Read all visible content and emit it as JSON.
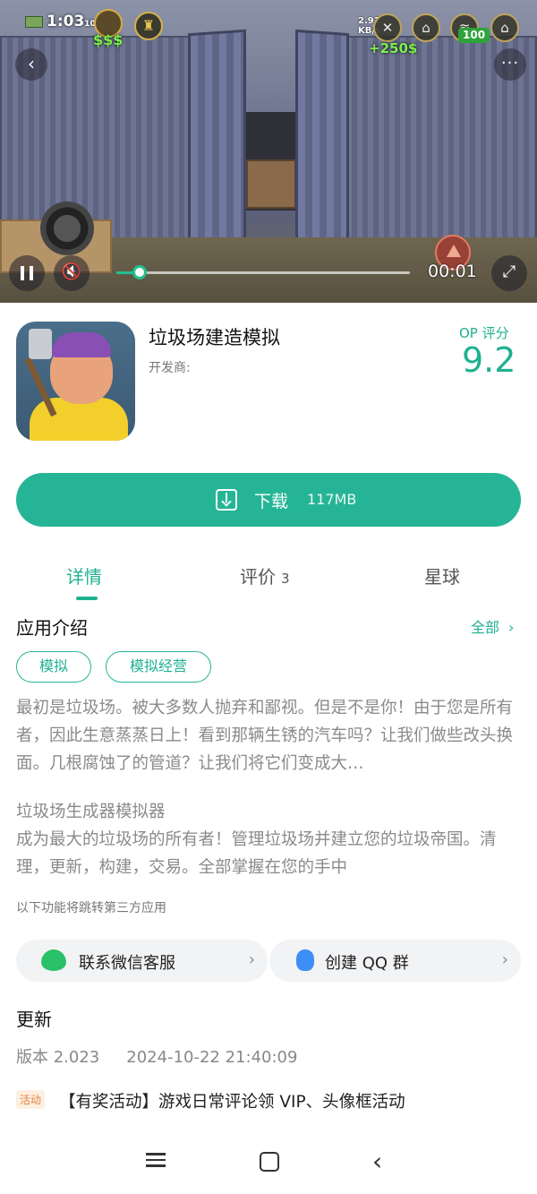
{
  "video": {
    "hud": {
      "cash": "1:03",
      "cash_suffix": "10",
      "dollars": "$$$",
      "net_speed": "2.91\nKB/s",
      "income": "+250$",
      "battery": "100"
    },
    "time": "00:01",
    "progress": 0.08
  },
  "app": {
    "title": "垃圾场建造模拟",
    "developer": "开发商:",
    "score_label": "OP 评分",
    "score": "9.2"
  },
  "download": {
    "label": "下载",
    "size": "117MB"
  },
  "tabs": [
    {
      "label": "详情",
      "count": ""
    },
    {
      "label": "评价",
      "count": "3"
    },
    {
      "label": "星球",
      "count": ""
    }
  ],
  "intro": {
    "title": "应用介绍",
    "all_link": "全部",
    "tags": [
      "模拟",
      "模拟经营"
    ],
    "description": "最初是垃圾场。被大多数人抛弃和鄙视。但是不是你！由于您是所有者，因此生意蒸蒸日上！看到那辆生锈的汽车吗？让我们做些改头换面。几根腐蚀了的管道？让我们将它们变成大…",
    "subheading": "垃圾场生成器模拟器",
    "body": "成为最大的垃圾场的所有者！管理垃圾场并建立您的垃圾帝国。清理，更新，构建，交易。全部掌握在您的手中",
    "third_party_note": "以下功能将跳转第三方应用"
  },
  "contacts": [
    {
      "label": "联系微信客服",
      "icon": "wechat-icon"
    },
    {
      "label": "创建 QQ 群",
      "icon": "qq-icon"
    }
  ],
  "update": {
    "title": "更新",
    "version": "版本 2.023",
    "date": "2024-10-22 21:40:09",
    "badge": "活动",
    "event": "【有奖活动】游戏日常评论领 VIP、头像框活动"
  },
  "colors": {
    "accent": "#20b191",
    "button": "#25b596"
  }
}
